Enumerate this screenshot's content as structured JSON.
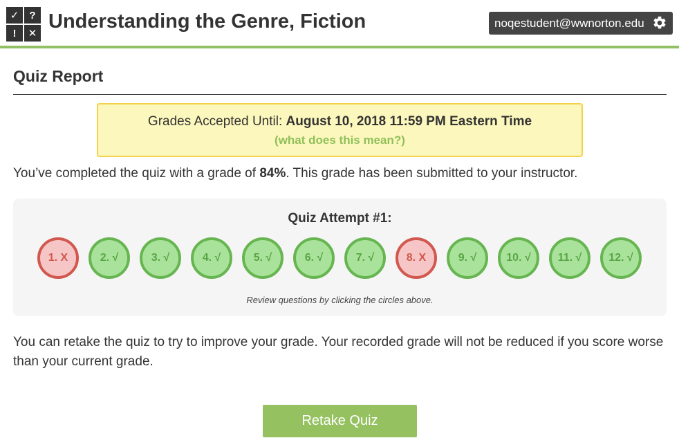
{
  "header": {
    "logo_glyphs": [
      "✓",
      "?",
      "!",
      "✕"
    ],
    "title": "Understanding the Genre, Fiction",
    "user_email": "noqestudent@wwnorton.edu",
    "settings_icon": "gear-icon"
  },
  "page_title": "Quiz Report",
  "notice": {
    "label": "Grades Accepted Until: ",
    "deadline": "August 10, 2018 11:59 PM Eastern Time",
    "link": "(what does this mean?)"
  },
  "completion": {
    "prefix": "You’ve completed the quiz with a grade of ",
    "grade": "84%",
    "suffix": ". This grade has been submitted to your instructor."
  },
  "attempt": {
    "title": "Quiz Attempt #1:",
    "questions": [
      {
        "label": "1. X",
        "status": "wrong"
      },
      {
        "label": "2. √",
        "status": "correct"
      },
      {
        "label": "3. √",
        "status": "correct"
      },
      {
        "label": "4. √",
        "status": "correct"
      },
      {
        "label": "5. √",
        "status": "correct"
      },
      {
        "label": "6. √",
        "status": "correct"
      },
      {
        "label": "7. √",
        "status": "correct"
      },
      {
        "label": "8. X",
        "status": "wrong"
      },
      {
        "label": "9. √",
        "status": "correct"
      },
      {
        "label": "10. √",
        "status": "correct"
      },
      {
        "label": "11. √",
        "status": "correct"
      },
      {
        "label": "12. √",
        "status": "correct"
      }
    ],
    "review_note": "Review questions by clicking the circles above."
  },
  "retake": {
    "text": "You can retake the quiz to try to improve your grade. Your recorded grade will not be reduced if you score worse than your current grade.",
    "button_label": "Retake Quiz"
  },
  "colors": {
    "accent_green": "#92c163",
    "correct_fill": "#a9e39b",
    "correct_border": "#67b551",
    "wrong_fill": "#f6c6c6",
    "wrong_border": "#d1584f",
    "notice_bg": "#fcf7bc",
    "notice_border": "#f2d24b"
  }
}
